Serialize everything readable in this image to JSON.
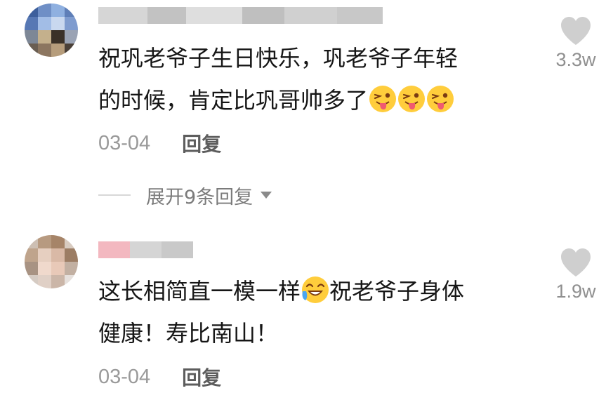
{
  "comments": [
    {
      "text_line1": "祝巩老爷子生日快乐，巩老爷子年轻",
      "text_line2": "的时候，肯定比巩哥帅多了",
      "date": "03-04",
      "reply_label": "回复",
      "like_count": "3.3w",
      "emoji_name": "tongue-wink-emoji"
    },
    {
      "text_line1_a": "这长相简直一模一样",
      "text_line1_b": "祝老爷子身体",
      "text_line2": "健康！寿比南山！",
      "date": "03-04",
      "reply_label": "回复",
      "like_count": "1.9w",
      "emoji_name": "laugh-cry-emoji"
    }
  ],
  "expand_replies": {
    "label": "展开9条回复",
    "icon": "caret-down-icon"
  },
  "colors": {
    "text": "#161616",
    "muted": "#9a9a9a",
    "reply": "#5d5d5d",
    "heart": "#cfcfcf",
    "emoji_yellow": "#ffcd3c"
  }
}
